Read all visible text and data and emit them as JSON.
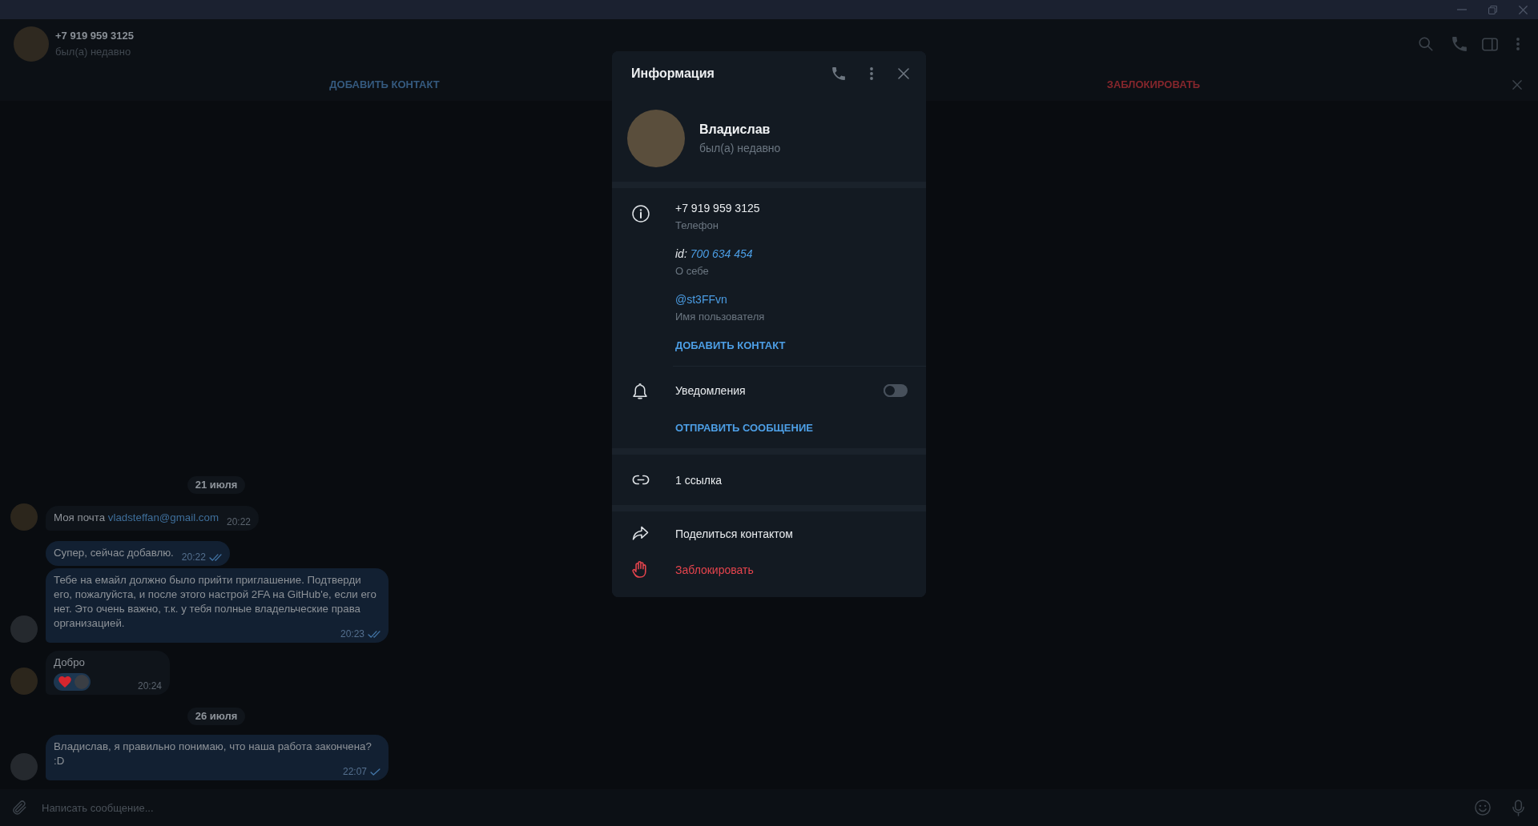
{
  "chat_header": {
    "title": "+7 919 959 3125",
    "status": "был(а) недавно"
  },
  "action_bar": {
    "add_contact": "ДОБАВИТЬ КОНТАКТ",
    "block": "ЗАБЛОКИРОВАТЬ"
  },
  "history": [
    {
      "kind": "date",
      "text": "21 июля"
    },
    {
      "kind": "message",
      "outgoing": false,
      "show_avatar": true,
      "text": "Моя почта",
      "link": "vladsteffan@gmail.com",
      "time": "20:22"
    },
    {
      "kind": "message",
      "outgoing": true,
      "show_avatar": false,
      "text": "Супер, сейчас добавлю.",
      "time": "20:22",
      "read": true
    },
    {
      "kind": "message",
      "outgoing": true,
      "show_avatar": true,
      "text": "Тебе на емайл должно было прийти приглашение. Подтверди его, пожалуйста, и после этого настрой 2FA на GitHub'е, если его нет. Это очень важно, т.к. у тебя полные владельческие права организацией.",
      "time": "20:23",
      "read": true
    },
    {
      "kind": "message",
      "outgoing": false,
      "show_avatar": true,
      "text": "Добро",
      "reaction": {
        "selected": true
      },
      "time": "20:24"
    },
    {
      "kind": "date",
      "text": "26 июля"
    },
    {
      "kind": "message",
      "outgoing": true,
      "show_avatar": true,
      "text": "Владислав, я правильно понимаю, что наша работа закончена? :D",
      "time": "22:07",
      "read": false
    }
  ],
  "composer": {
    "placeholder": "Написать сообщение..."
  },
  "info": {
    "title": "Информация",
    "name": "Владислав",
    "status": "был(а) недавно",
    "details": [
      {
        "kind": "phone",
        "value": "+7 919 959 3125",
        "label": "Телефон"
      },
      {
        "kind": "bio",
        "value": "id:",
        "link": "700 634 454",
        "label": "О себе"
      },
      {
        "kind": "username",
        "value": "@st3FFvn",
        "label": "Имя пользователя"
      }
    ],
    "add_contact": "ДОБАВИТЬ КОНТАКТ",
    "notifications": {
      "label": "Уведомления",
      "on": false
    },
    "send_message": "ОТПРАВИТЬ СООБЩЕНИЕ",
    "links": "1 ссылка",
    "actions": [
      {
        "kind": "share",
        "label": "Поделиться контактом"
      },
      {
        "kind": "block",
        "label": "Заблокировать"
      }
    ]
  }
}
